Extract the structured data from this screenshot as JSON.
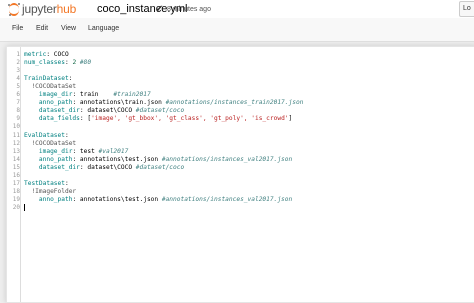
{
  "header": {
    "logo_text_a": "jupyter",
    "logo_text_b": "hub",
    "filename": "coco_instance.yml",
    "saved_check": "✔",
    "last_saved": "8 minutes ago",
    "login_label": "Lo"
  },
  "menu": {
    "items": [
      {
        "label": "File"
      },
      {
        "label": "Edit"
      },
      {
        "label": "View"
      },
      {
        "label": "Language"
      }
    ]
  },
  "editor": {
    "lines": [
      {
        "n": "1",
        "s1": "metric",
        "s2": ": COCO",
        "s3": "",
        "s4": ""
      },
      {
        "n": "2",
        "s1": "num_classes",
        "s2": ": ",
        "s3": "2",
        "s4": " #80"
      },
      {
        "n": "3",
        "s1": "",
        "s2": "",
        "s3": "",
        "s4": ""
      },
      {
        "n": "4",
        "s1": "TrainDataset",
        "s2": ":",
        "s3": "",
        "s4": ""
      },
      {
        "n": "5",
        "s1": "",
        "s2": "  !COCODataSet",
        "s3": "",
        "s4": ""
      },
      {
        "n": "6",
        "s1": "    image_dir",
        "s2": ": train    ",
        "s3": "",
        "s4": "#train2017"
      },
      {
        "n": "7",
        "s1": "    anno_path",
        "s2": ": annotations\\train.json ",
        "s3": "",
        "s4": "#annotations/instances_train2017.json"
      },
      {
        "n": "8",
        "s1": "    dataset_dir",
        "s2": ": dataset\\COCO ",
        "s3": "",
        "s4": "#dataset/coco"
      },
      {
        "n": "9",
        "s1": "    data_fields",
        "s2": ": [",
        "s3": "'image', 'gt_bbox', 'gt_class', 'gt_poly', 'is_crowd'",
        "s4": "]"
      },
      {
        "n": "10",
        "s1": "",
        "s2": "",
        "s3": "",
        "s4": ""
      },
      {
        "n": "11",
        "s1": "EvalDataset",
        "s2": ":",
        "s3": "",
        "s4": ""
      },
      {
        "n": "12",
        "s1": "",
        "s2": "  !COCODataSet",
        "s3": "",
        "s4": ""
      },
      {
        "n": "13",
        "s1": "    image_dir",
        "s2": ": test ",
        "s3": "",
        "s4": "#val2017"
      },
      {
        "n": "14",
        "s1": "    anno_path",
        "s2": ": annotations\\test.json ",
        "s3": "",
        "s4": "#annotations/instances_val2017.json"
      },
      {
        "n": "15",
        "s1": "    dataset_dir",
        "s2": ": dataset\\COCO ",
        "s3": "",
        "s4": "#dataset/coco"
      },
      {
        "n": "16",
        "s1": "",
        "s2": "",
        "s3": "",
        "s4": ""
      },
      {
        "n": "17",
        "s1": "TestDataset",
        "s2": ":",
        "s3": "",
        "s4": ""
      },
      {
        "n": "18",
        "s1": "",
        "s2": "  !ImageFolder",
        "s3": "",
        "s4": ""
      },
      {
        "n": "19",
        "s1": "    anno_path",
        "s2": ": annotations\\test.json ",
        "s3": "",
        "s4": "#annotations/instances_val2017.json"
      },
      {
        "n": "20",
        "s1": "",
        "s2": "",
        "s3": "",
        "s4": ""
      }
    ]
  },
  "colors": {
    "brand_orange": "#f37726",
    "yaml_key": "#008080",
    "yaml_comment": "#408080",
    "yaml_string": "#ba2121",
    "yaml_number": "#116644"
  },
  "icons": [
    "jupyter-logo-icon",
    "saved-check-icon"
  ]
}
